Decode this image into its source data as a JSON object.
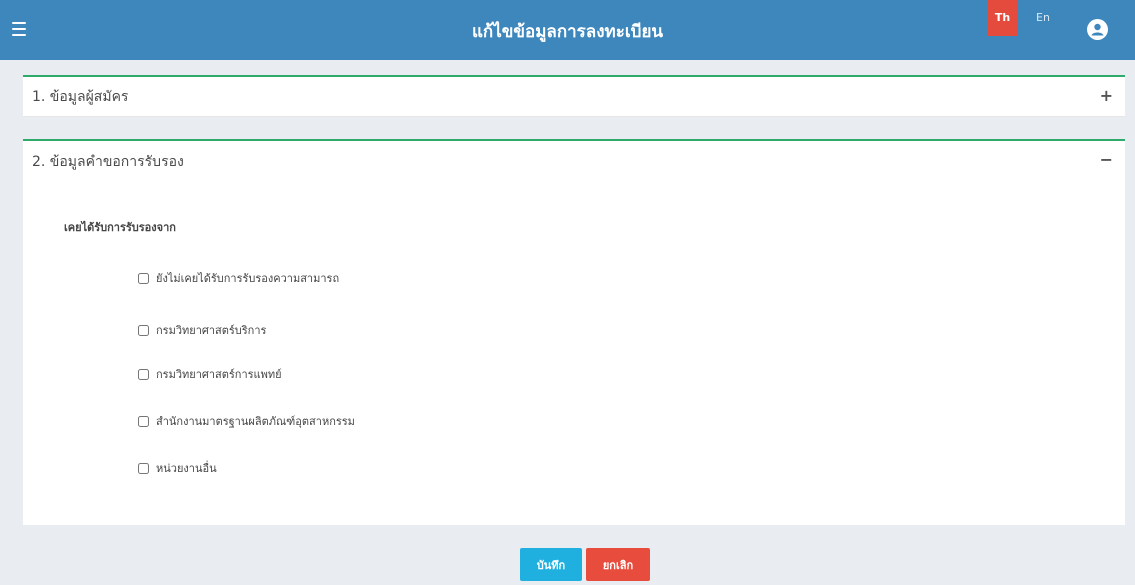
{
  "header": {
    "title": "แก้ไขข้อมูลการลงทะเบียน",
    "lang_th": "Th",
    "lang_en": "En",
    "menu_icon": "hamburger-icon",
    "user_icon": "user-circle-icon"
  },
  "panels": [
    {
      "title": "1. ข้อมูลผู้สมัคร",
      "toggle": "+"
    },
    {
      "title": "2. ข้อมูลคำขอการรับรอง",
      "toggle": "−"
    }
  ],
  "certification": {
    "label": "เคยได้รับการรับรองจาก",
    "options": [
      {
        "label": "ยังไม่เคยได้รับการรับรองความสามารถ",
        "checked": false
      },
      {
        "label": "กรมวิทยาศาสตร์บริการ",
        "checked": false
      },
      {
        "label": "กรมวิทยาศาสตร์การแพทย์",
        "checked": false
      },
      {
        "label": "สำนักงานมาตรฐานผลิตภัณฑ์อุตสาหกรรม",
        "checked": false
      },
      {
        "label": "หน่วยงานอื่น",
        "checked": false
      }
    ]
  },
  "buttons": {
    "save_label": "บันทึก",
    "cancel_label": "ยกเลิก"
  },
  "colors": {
    "header": "#3d87bd",
    "accent_border": "#2eab6a",
    "lang_active": "#e54b3c",
    "save": "#1fb0e0",
    "cancel": "#e84c3d"
  }
}
